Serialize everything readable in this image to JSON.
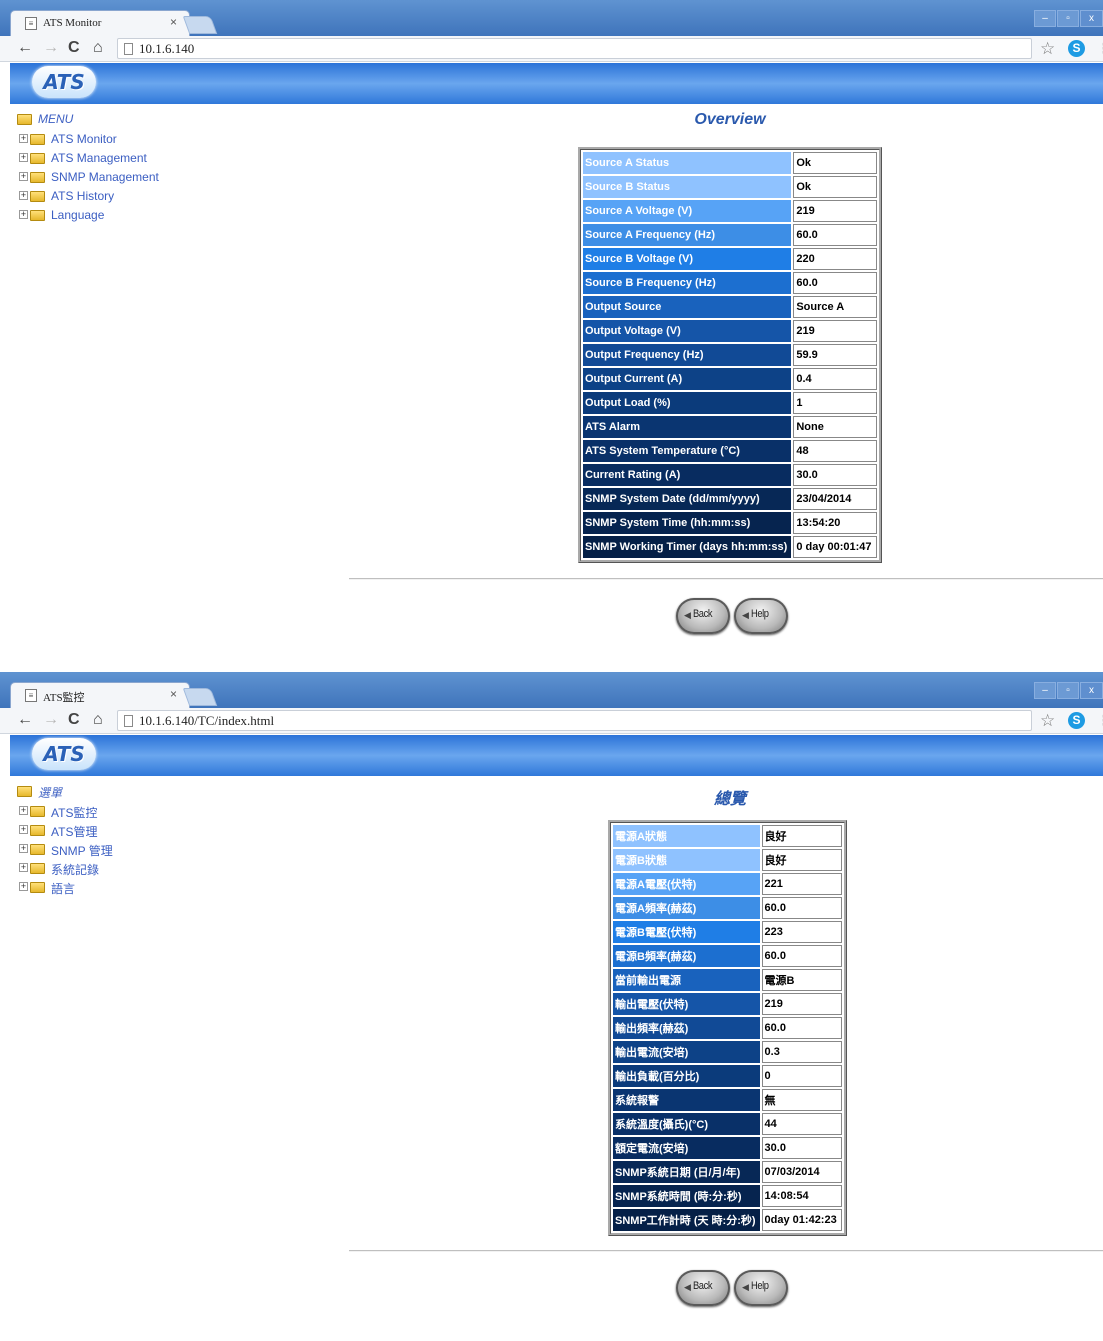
{
  "shot_en": {
    "tab_title": "ATS Monitor",
    "url": "10.1.6.140",
    "logo": "ATS",
    "menu": {
      "title": "MENU",
      "items": [
        "ATS Monitor",
        "ATS Management",
        "SNMP Management",
        "ATS History",
        "Language"
      ]
    },
    "heading": "Overview",
    "rows": [
      {
        "label": "Source A Status",
        "value": "Ok"
      },
      {
        "label": "Source B Status",
        "value": "Ok"
      },
      {
        "label": "Source A Voltage (V)",
        "value": "219"
      },
      {
        "label": "Source A Frequency (Hz)",
        "value": "60.0"
      },
      {
        "label": "Source B Voltage (V)",
        "value": "220"
      },
      {
        "label": "Source B Frequency (Hz)",
        "value": "60.0"
      },
      {
        "label": "Output Source",
        "value": "Source A"
      },
      {
        "label": "Output Voltage (V)",
        "value": "219"
      },
      {
        "label": "Output Frequency (Hz)",
        "value": "59.9"
      },
      {
        "label": "Output Current (A)",
        "value": "0.4"
      },
      {
        "label": "Output Load (%)",
        "value": "1"
      },
      {
        "label": "ATS Alarm",
        "value": "None"
      },
      {
        "label": "ATS System Temperature (°C)",
        "value": "48"
      },
      {
        "label": "Current Rating (A)",
        "value": "30.0"
      },
      {
        "label": "SNMP System Date (dd/mm/yyyy)",
        "value": "23/04/2014"
      },
      {
        "label": "SNMP System Time (hh:mm:ss)",
        "value": "13:54:20"
      },
      {
        "label": "SNMP Working Timer (days hh:mm:ss)",
        "value": "0 day 00:01:47"
      }
    ],
    "buttons": {
      "back": "Back",
      "help": "Help"
    }
  },
  "shot_tc": {
    "tab_title": "ATS監控",
    "url": "10.1.6.140/TC/index.html",
    "logo": "ATS",
    "menu": {
      "title": "選單",
      "items": [
        "ATS監控",
        "ATS管理",
        "SNMP 管理",
        "系統記錄",
        "語言"
      ]
    },
    "heading": "總覽",
    "rows": [
      {
        "label": "電源A狀態",
        "value": "良好"
      },
      {
        "label": "電源B狀態",
        "value": "良好"
      },
      {
        "label": "電源A電壓(伏特)",
        "value": "221"
      },
      {
        "label": "電源A頻率(赫茲)",
        "value": "60.0"
      },
      {
        "label": "電源B電壓(伏特)",
        "value": "223"
      },
      {
        "label": "電源B頻率(赫茲)",
        "value": "60.0"
      },
      {
        "label": "當前輸出電源",
        "value": "電源B"
      },
      {
        "label": "輸出電壓(伏特)",
        "value": "219"
      },
      {
        "label": "輸出頻率(赫茲)",
        "value": "60.0"
      },
      {
        "label": "輸出電流(安培)",
        "value": "0.3"
      },
      {
        "label": "輸出負載(百分比)",
        "value": "0"
      },
      {
        "label": "系統報警",
        "value": "無"
      },
      {
        "label": "系統溫度(攝氏)(°C)",
        "value": "44"
      },
      {
        "label": "額定電流(安培)",
        "value": "30.0"
      },
      {
        "label": "SNMP系統日期 (日/月/年)",
        "value": "07/03/2014"
      },
      {
        "label": "SNMP系統時間 (時:分:秒)",
        "value": "14:08:54"
      },
      {
        "label": "SNMP工作計時 (天 時:分:秒)",
        "value": "0day 01:42:23"
      }
    ],
    "buttons": {
      "back": "Back",
      "help": "Help"
    }
  },
  "colors": {
    "label_rows": [
      "#8fc2ff",
      "#8fc2ff",
      "#57a3f6",
      "#3d8ee6",
      "#1f7ee6",
      "#1c6fd0",
      "#1962bd",
      "#1555a8",
      "#114a96",
      "#0d4287",
      "#0b3b7b",
      "#0a3571",
      "#093068",
      "#082c60",
      "#072856",
      "#06244f",
      "#052047"
    ],
    "menu_link": "#3b5ec2",
    "heading": "#2a59ad"
  }
}
